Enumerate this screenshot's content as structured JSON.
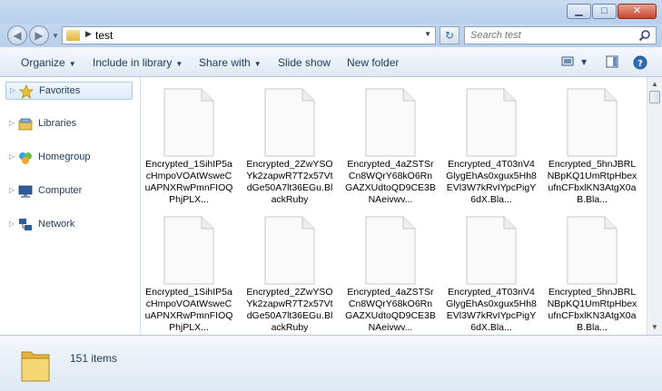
{
  "address": {
    "crumb": "test"
  },
  "search": {
    "placeholder": "Search test"
  },
  "toolbar": {
    "organize": "Organize",
    "include_in_library": "Include in library",
    "share_with": "Share with",
    "slide_show": "Slide show",
    "new_folder": "New folder"
  },
  "nav": {
    "items": [
      {
        "label": "Favorites",
        "icon": "star-icon"
      },
      {
        "label": "Libraries",
        "icon": "libraries-icon"
      },
      {
        "label": "Homegroup",
        "icon": "homegroup-icon"
      },
      {
        "label": "Computer",
        "icon": "computer-icon"
      },
      {
        "label": "Network",
        "icon": "network-icon"
      }
    ]
  },
  "files": [
    {
      "name": "Encrypted_1SihIP5acHmpoVOAtWsweCuAPNXRwPmnFIOQPhjPLX..."
    },
    {
      "name": "Encrypted_2ZwYSOYk2zapwR7T2x57VtdGe50A7lt36EGu.BlackRuby"
    },
    {
      "name": "Encrypted_4aZSTSrCn8WQrY68kO6RnGAZXUdtoQD9CE3BNAeivwv..."
    },
    {
      "name": "Encrypted_4T03nV4GlygEhAs0xgux5Hh8EVl3W7kRvIYpcPigY6dX.Bla..."
    },
    {
      "name": "Encrypted_5hnJBRLNBpKQ1UmRtpHbexufnCFbxlKN3AtgX0aB.Bla..."
    },
    {
      "name": "Encrypted_1SihIP5acHmpoVOAtWsweCuAPNXRwPmnFIOQPhjPLX..."
    },
    {
      "name": "Encrypted_2ZwYSOYk2zapwR7T2x57VtdGe50A7lt36EGu.BlackRuby"
    },
    {
      "name": "Encrypted_4aZSTSrCn8WQrY68kO6RnGAZXUdtoQD9CE3BNAeivwv..."
    },
    {
      "name": "Encrypted_4T03nV4GlygEhAs0xgux5Hh8EVl3W7kRvIYpcPigY6dX.Bla..."
    },
    {
      "name": "Encrypted_5hnJBRLNBpKQ1UmRtpHbexufnCFbxlKN3AtgX0aB.Bla..."
    }
  ],
  "status": {
    "item_count": "151 items"
  },
  "colors": {
    "accent": "#1e395b",
    "chrome": "#c3d7ef",
    "close": "#c8452d"
  }
}
